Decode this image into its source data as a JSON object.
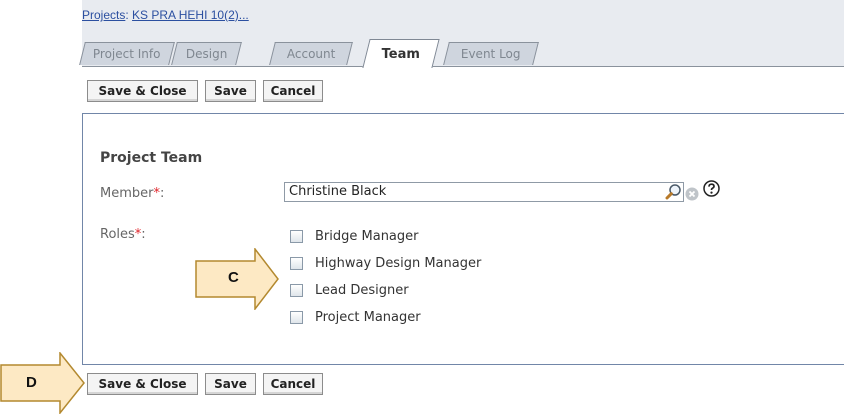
{
  "breadcrumb": {
    "root": "Projects",
    "separator": ":",
    "current": "KS PRA HEHI 10(2)..."
  },
  "tabs": [
    {
      "label": "Project Info",
      "active": false
    },
    {
      "label": "Design",
      "active": false
    },
    {
      "label": "Account",
      "active": false
    },
    {
      "label": "Team",
      "active": true
    },
    {
      "label": "Event Log",
      "active": false
    }
  ],
  "toolbar": {
    "save_close": "Save & Close",
    "save": "Save",
    "cancel": "Cancel"
  },
  "form": {
    "section_title": "Project Team",
    "member_label": "Member",
    "roles_label": "Roles",
    "required_marker": "*",
    "label_colon": ":",
    "member_value": "Christine Black",
    "roles": [
      {
        "label": "Bridge Manager",
        "checked": false
      },
      {
        "label": "Highway Design Manager",
        "checked": false
      },
      {
        "label": "Lead Designer",
        "checked": false
      },
      {
        "label": "Project Manager",
        "checked": false
      }
    ]
  },
  "annotations": {
    "callout_c": "C",
    "callout_d": "D"
  },
  "icons": {
    "lookup": "magnifier-icon",
    "clear": "clear-icon",
    "help": "help-icon"
  },
  "colors": {
    "link": "#2b4fa0",
    "required": "#e0242a",
    "panel_border": "#7186a8",
    "tab_inactive": "#cfd5de",
    "callout_fill": "#fde9c4",
    "callout_stroke": "#b3892f"
  }
}
